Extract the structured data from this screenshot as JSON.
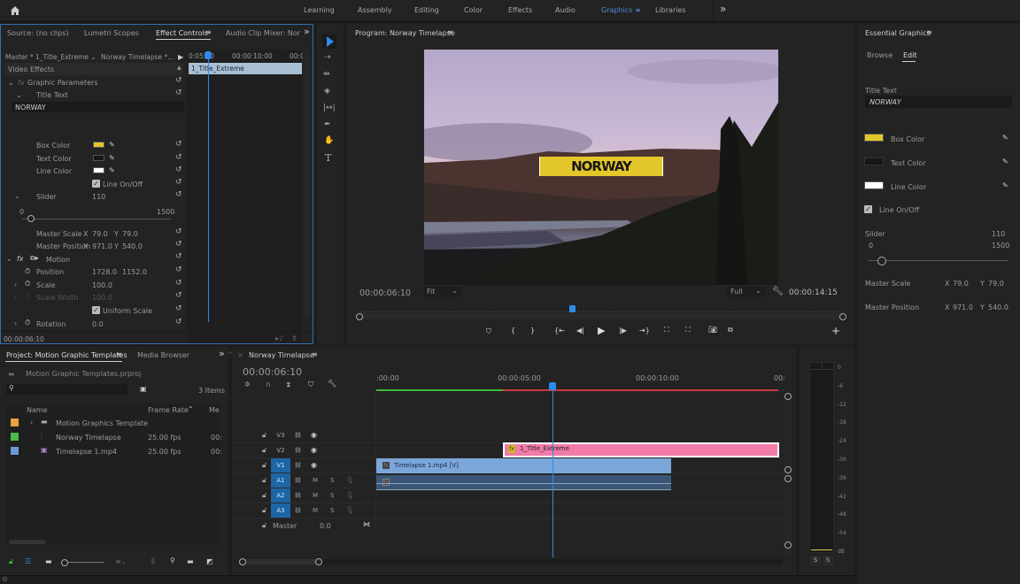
{
  "workspaces": {
    "items": [
      "Learning",
      "Assembly",
      "Editing",
      "Color",
      "Effects",
      "Audio",
      "Graphics",
      "Libraries"
    ],
    "active": "Graphics",
    "more": "»"
  },
  "source_panel": {
    "tabs": [
      "Source: (no clips)",
      "Lumetri Scopes",
      "Effect Controls",
      "Audio Clip Mixer: Nor"
    ],
    "active_tab": "Effect Controls",
    "more": "»",
    "master_label": "Master * 1_Title_Extreme",
    "sequence_label": "Norway Timelapse *...",
    "ruler": [
      "0:05:00",
      "00:00:10:00",
      "00:0"
    ],
    "clip_name": "1_Title_Extreme",
    "section": "Video Effects",
    "graphic_params": "Graphic Parameters",
    "title_text_label": "Title Text",
    "title_text_value": "NORWAY",
    "box_color_label": "Box Color",
    "text_color_label": "Text Color",
    "line_color_label": "Line Color",
    "line_onoff_label": "Line On/Off",
    "slider_label": "Slider",
    "slider_value": "110",
    "slider_min": "0",
    "slider_max": "1500",
    "master_scale_label": "Master Scale",
    "master_scale_x": "79.0",
    "master_scale_y": "79.0",
    "master_position_label": "Master Position",
    "master_position_x": "971.0",
    "master_position_y": "540.0",
    "x_label": "X",
    "y_label": "Y",
    "motion_label": "Motion",
    "position_label": "Position",
    "position_x": "1728.0",
    "position_y": "1152.0",
    "scale_label": "Scale",
    "scale_value": "100.0",
    "scale_width_label": "Scale Width",
    "scale_width_value": "100.0",
    "uniform_scale_label": "Uniform Scale",
    "rotation_label": "Rotation",
    "rotation_value": "0.0",
    "timecode": "00:00:06:10"
  },
  "colors": {
    "box": "#e3c72a",
    "text": "#161616",
    "line": "#ffffff",
    "accent": "#2d8ceb",
    "title_clip": "#f07aa8",
    "video_clip": "#7ba6d9",
    "audio_clip": "#3b5677"
  },
  "program": {
    "title": "Program: Norway Timelapse",
    "overlay_text": "NORWAY",
    "timecode": "00:00:06:10",
    "fit": "Fit",
    "quality": "Full",
    "duration": "00:00:14:15",
    "playhead_fraction": 0.44
  },
  "essential_graphics": {
    "title": "Essential Graphics",
    "tabs": [
      "Browse",
      "Edit"
    ],
    "active_tab": "Edit",
    "title_text_label": "Title Text",
    "title_text_value": "NORWAY",
    "box_color_label": "Box Color",
    "text_color_label": "Text Color",
    "line_color_label": "Line Color",
    "line_onoff_label": "Line On/Off",
    "slider_label": "Slider",
    "slider_value": "110",
    "slider_min": "0",
    "slider_max": "1500",
    "master_scale_label": "Master Scale",
    "master_scale_x": "79.0",
    "master_scale_y": "79.0",
    "master_position_label": "Master Position",
    "master_position_x": "971.0",
    "master_position_y": "540.0",
    "x_label": "X",
    "y_label": "Y"
  },
  "project": {
    "tabs": [
      "Project: Motion Graphic Templates",
      "Media Browser"
    ],
    "active_tab": "Project: Motion Graphic Templates",
    "file": "Motion Graphic Templates.prproj",
    "items_count": "3 Items",
    "search_placeholder": "",
    "columns": [
      "Name",
      "Frame Rate",
      "Me"
    ],
    "rows": [
      {
        "color": "#e8a33a",
        "name": "Motion Graphics Template",
        "fps": "",
        "media": "",
        "type": "folder"
      },
      {
        "color": "#4cbb4c",
        "name": "Norway Timelapse",
        "fps": "25.00 fps",
        "media": "00:",
        "type": "sequence"
      },
      {
        "color": "#6a9ad6",
        "name": "Timelapse 1.mp4",
        "fps": "25.00 fps",
        "media": "00:",
        "type": "clip"
      }
    ]
  },
  "timeline": {
    "title": "Norway Timelapse",
    "timecode": "00:00:06:10",
    "ruler": [
      ":00:00",
      "00:00:05:00",
      "00:00:10:00",
      "00:"
    ],
    "tracks": [
      {
        "name": "V3",
        "type": "video",
        "on": false
      },
      {
        "name": "V2",
        "type": "video",
        "on": false
      },
      {
        "name": "V1",
        "type": "video",
        "on": true
      },
      {
        "name": "A1",
        "type": "audio",
        "on": true
      },
      {
        "name": "A2",
        "type": "audio",
        "on": true
      },
      {
        "name": "A3",
        "type": "audio",
        "on": true
      }
    ],
    "mute": "M",
    "solo": "S",
    "master_label": "Master",
    "master_value": "0.0",
    "clips": [
      {
        "name": "1_Title_Extreme",
        "track": "V2"
      },
      {
        "name": "Timelapse 1.mp4 [V]",
        "track": "V1"
      },
      {
        "name": "",
        "track": "A1"
      }
    ]
  },
  "audio_meter": {
    "scale": [
      "0",
      "-6",
      "-12",
      "-18",
      "-24",
      "-30",
      "-36",
      "-42",
      "-48",
      "-54",
      "dB"
    ],
    "solo_buttons": [
      "S",
      "S"
    ]
  }
}
